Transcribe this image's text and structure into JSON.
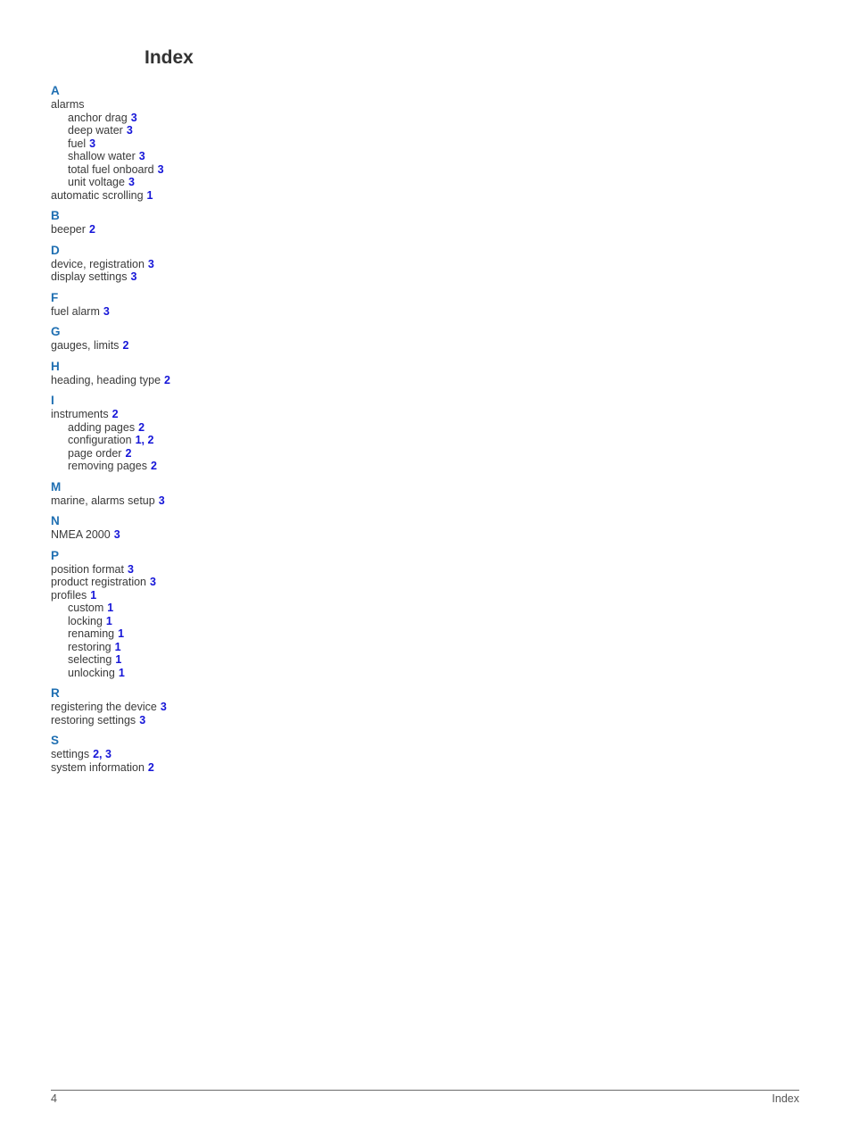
{
  "title": "Index",
  "sections": [
    {
      "letter": "A",
      "entries": [
        {
          "text": "alarms",
          "pages": "",
          "level": 0
        },
        {
          "text": "anchor drag",
          "pages": "3",
          "level": 1
        },
        {
          "text": "deep water",
          "pages": "3",
          "level": 1
        },
        {
          "text": "fuel",
          "pages": "3",
          "level": 1
        },
        {
          "text": "shallow water",
          "pages": "3",
          "level": 1
        },
        {
          "text": "total fuel onboard",
          "pages": "3",
          "level": 1
        },
        {
          "text": "unit voltage",
          "pages": "3",
          "level": 1
        },
        {
          "text": "automatic scrolling",
          "pages": "1",
          "level": 0
        }
      ]
    },
    {
      "letter": "B",
      "entries": [
        {
          "text": "beeper",
          "pages": "2",
          "level": 0
        }
      ]
    },
    {
      "letter": "D",
      "entries": [
        {
          "text": "device, registration",
          "pages": "3",
          "level": 0
        },
        {
          "text": "display settings",
          "pages": "3",
          "level": 0
        }
      ]
    },
    {
      "letter": "F",
      "entries": [
        {
          "text": "fuel alarm",
          "pages": "3",
          "level": 0
        }
      ]
    },
    {
      "letter": "G",
      "entries": [
        {
          "text": "gauges, limits",
          "pages": "2",
          "level": 0
        }
      ]
    },
    {
      "letter": "H",
      "entries": [
        {
          "text": "heading, heading type",
          "pages": "2",
          "level": 0
        }
      ]
    },
    {
      "letter": "I",
      "entries": [
        {
          "text": "instruments",
          "pages": "2",
          "level": 0
        },
        {
          "text": "adding pages",
          "pages": "2",
          "level": 1
        },
        {
          "text": "configuration",
          "pages": "1, 2",
          "level": 1
        },
        {
          "text": "page order",
          "pages": "2",
          "level": 1
        },
        {
          "text": "removing pages",
          "pages": "2",
          "level": 1
        }
      ]
    },
    {
      "letter": "M",
      "entries": [
        {
          "text": "marine, alarms setup",
          "pages": "3",
          "level": 0
        }
      ]
    },
    {
      "letter": "N",
      "entries": [
        {
          "text": "NMEA 2000",
          "pages": "3",
          "level": 0
        }
      ]
    },
    {
      "letter": "P",
      "entries": [
        {
          "text": "position format",
          "pages": "3",
          "level": 0
        },
        {
          "text": "product registration",
          "pages": "3",
          "level": 0
        },
        {
          "text": "profiles",
          "pages": "1",
          "level": 0
        },
        {
          "text": "custom",
          "pages": "1",
          "level": 1
        },
        {
          "text": "locking",
          "pages": "1",
          "level": 1
        },
        {
          "text": "renaming",
          "pages": "1",
          "level": 1
        },
        {
          "text": "restoring",
          "pages": "1",
          "level": 1
        },
        {
          "text": "selecting",
          "pages": "1",
          "level": 1
        },
        {
          "text": "unlocking",
          "pages": "1",
          "level": 1
        }
      ]
    },
    {
      "letter": "R",
      "entries": [
        {
          "text": "registering the device",
          "pages": "3",
          "level": 0
        },
        {
          "text": "restoring settings",
          "pages": "3",
          "level": 0
        }
      ]
    },
    {
      "letter": "S",
      "entries": [
        {
          "text": "settings",
          "pages": "2, 3",
          "level": 0
        },
        {
          "text": "system information",
          "pages": "2",
          "level": 0
        }
      ]
    }
  ],
  "footer": {
    "page_number": "4",
    "section_name": "Index"
  }
}
